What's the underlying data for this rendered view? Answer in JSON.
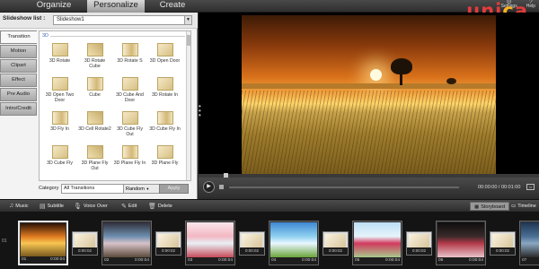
{
  "menu": {
    "tabs": [
      {
        "label": "Organize"
      },
      {
        "label": "Personalize"
      },
      {
        "label": "Create"
      }
    ],
    "icons": [
      {
        "label": "Settings",
        "icon": "gear-icon"
      },
      {
        "label": "Help",
        "icon": "help-icon"
      }
    ]
  },
  "brand": {
    "text_a": "uni",
    "text_c": "c",
    "text_b": "a",
    "color_main": "#e23c3c",
    "color_accent": "#ffb41f"
  },
  "slideshow": {
    "label": "Slideshow list :",
    "value": "Slideshow1"
  },
  "side_tabs": [
    {
      "label": "Transition"
    },
    {
      "label": "Motion"
    },
    {
      "label": "Clipart"
    },
    {
      "label": "Effect"
    },
    {
      "label": "Pre Audio"
    },
    {
      "label": "Intro/Credit"
    }
  ],
  "effects": {
    "category_heading": "3D",
    "items": [
      {
        "label": "3D Rotate"
      },
      {
        "label": "3D Rotate Cube"
      },
      {
        "label": "3D Rotate S"
      },
      {
        "label": "3D Open Door"
      },
      {
        "label": "3D Open Two Door"
      },
      {
        "label": "Cube"
      },
      {
        "label": "3D Cube And Door"
      },
      {
        "label": "3D Rotate In"
      },
      {
        "label": "3D Fly In"
      },
      {
        "label": "3D Cell Rotate2"
      },
      {
        "label": "3D Cube Fly Out"
      },
      {
        "label": "3D Cube Fly In"
      },
      {
        "label": "3D Cube Fly"
      },
      {
        "label": "3D Plane Fly Out"
      },
      {
        "label": "3D Plane Fly In"
      },
      {
        "label": "3D Plane Fly"
      }
    ]
  },
  "category_bar": {
    "label": "Category",
    "value": "All Transitions",
    "random_label": "Random",
    "apply_label": "Apply"
  },
  "player": {
    "timecode": "00:00:00 / 00:01:00"
  },
  "toolbar": {
    "music": "Music",
    "subtitle": "Subtitle",
    "voice_over": "Voice Over",
    "edit": "Edit",
    "delete": "Delete",
    "storyboard": "Storyboard",
    "timeline": "Timeline"
  },
  "storyboard": {
    "scroll_label": "01",
    "slides": [
      {
        "num": "01",
        "duration": "0:00:04",
        "colors": [
          "#2a1306",
          "#e07a20",
          "#f7c552",
          "#7a5a1e"
        ]
      },
      {
        "num": "02",
        "duration": "0:00:04",
        "colors": [
          "#2f2f3a",
          "#6e8fb0",
          "#d7c2c8",
          "#5b4a3a"
        ]
      },
      {
        "num": "03",
        "duration": "0:00:04",
        "colors": [
          "#fbe7ec",
          "#f3b7c3",
          "#e8f0f5",
          "#c84a5a"
        ]
      },
      {
        "num": "04",
        "duration": "0:00:04",
        "colors": [
          "#3f88d4",
          "#8fd0f0",
          "#e9f7ff",
          "#6aa53a"
        ]
      },
      {
        "num": "05",
        "duration": "0:00:04",
        "colors": [
          "#bcdff5",
          "#e7f4fb",
          "#d23a5e",
          "#a7c98e"
        ]
      },
      {
        "num": "06",
        "duration": "0:00:04",
        "colors": [
          "#0d0d0d",
          "#3a2a2a",
          "#b33a4a",
          "#e8c3c8"
        ]
      },
      {
        "num": "07",
        "duration": "0:00:04",
        "colors": [
          "#1f3552",
          "#4a6f95",
          "#8aa7c2",
          "#2a2a2a"
        ]
      }
    ],
    "transitions": [
      {
        "duration": "0:00:02"
      },
      {
        "duration": "0:00:02"
      },
      {
        "duration": "0:00:02"
      },
      {
        "duration": "0:00:02"
      },
      {
        "duration": "0:00:02"
      },
      {
        "duration": "0:00:02"
      }
    ]
  }
}
